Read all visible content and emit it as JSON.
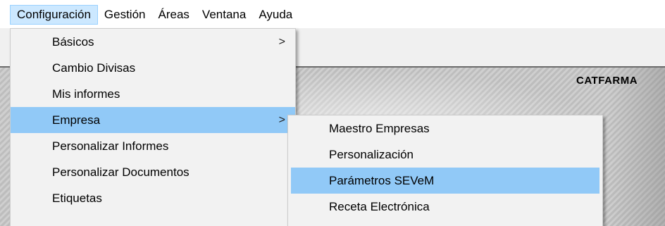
{
  "menubar": {
    "items": [
      {
        "label": "Configuración"
      },
      {
        "label": "Gestión"
      },
      {
        "label": "Áreas"
      },
      {
        "label": "Ventana"
      },
      {
        "label": "Ayuda"
      }
    ]
  },
  "background": {
    "brand_text": "CATFARMA"
  },
  "config_menu": {
    "items": [
      {
        "label": "Básicos",
        "has_submenu": true
      },
      {
        "label": "Cambio Divisas"
      },
      {
        "label": "Mis informes"
      },
      {
        "label": "Empresa",
        "has_submenu": true,
        "highlighted": true
      },
      {
        "label": "Personalizar Informes"
      },
      {
        "label": "Personalizar Documentos"
      },
      {
        "label": "Etiquetas"
      }
    ],
    "submenu_arrow": ">"
  },
  "empresa_menu": {
    "items": [
      {
        "label": "Maestro Empresas"
      },
      {
        "label": "Personalización"
      },
      {
        "label": "Parámetros SEVeM",
        "highlighted": true
      },
      {
        "label": "Receta Electrónica"
      }
    ]
  },
  "colors": {
    "menu_background": "#f2f2f2",
    "highlight": "#91c9f7",
    "menubar_active": "#cce8ff"
  }
}
